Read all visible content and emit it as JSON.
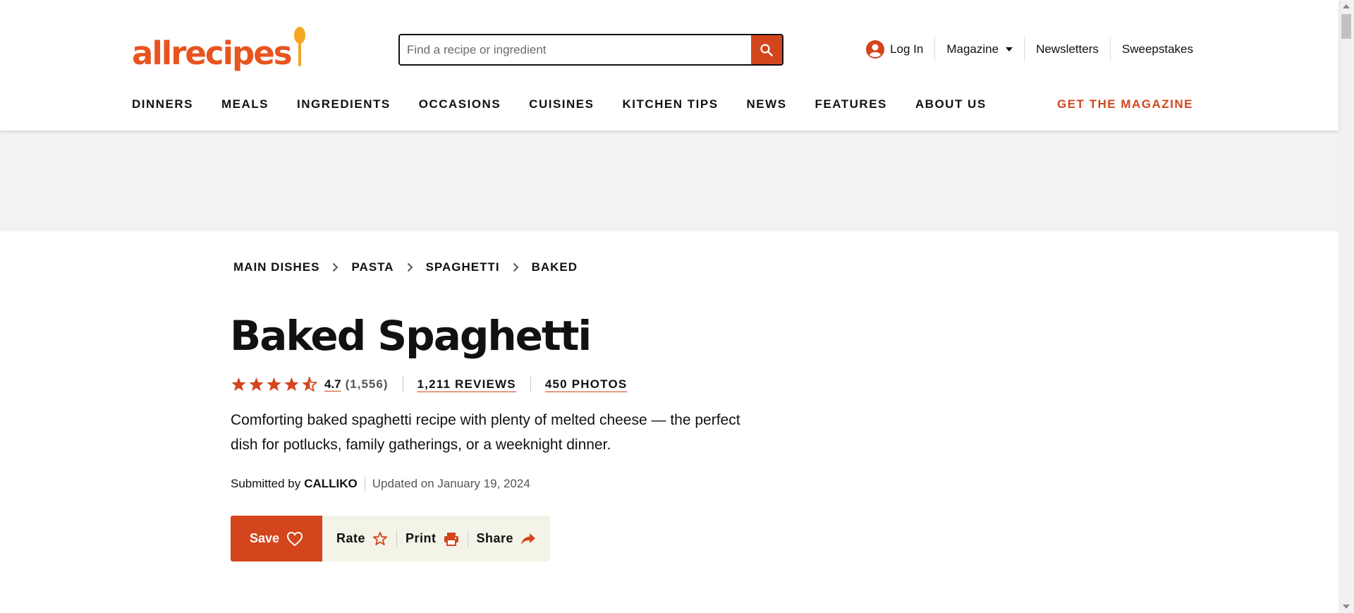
{
  "brand": {
    "logo_text": "allrecipes",
    "accent": "#d3451c",
    "logo_orange": "#e8541f",
    "spoon_yellow": "#f5a623"
  },
  "search": {
    "placeholder": "Find a recipe or ingredient",
    "icon": "search-icon"
  },
  "utility_nav": {
    "login": "Log In",
    "magazine": "Magazine",
    "newsletters": "Newsletters",
    "sweepstakes": "Sweepstakes"
  },
  "main_nav": {
    "items": [
      "DINNERS",
      "MEALS",
      "INGREDIENTS",
      "OCCASIONS",
      "CUISINES",
      "KITCHEN TIPS",
      "NEWS",
      "FEATURES",
      "ABOUT US"
    ],
    "cta": "GET THE MAGAZINE"
  },
  "breadcrumb": [
    "MAIN DISHES",
    "PASTA",
    "SPAGHETTI",
    "BAKED"
  ],
  "recipe": {
    "title": "Baked Spaghetti",
    "rating": "4.7",
    "rating_stars": 4.5,
    "rating_count": "(1,556)",
    "reviews": "1,211 REVIEWS",
    "photos": "450 PHOTOS",
    "description": "Comforting baked spaghetti recipe with plenty of melted cheese — the perfect dish for potlucks, family gatherings, or a weeknight dinner.",
    "submitted_by_label": "Submitted by",
    "author": "CALLIKO",
    "updated": "Updated on January 19, 2024"
  },
  "actions": {
    "save": "Save",
    "rate": "Rate",
    "print": "Print",
    "share": "Share"
  }
}
